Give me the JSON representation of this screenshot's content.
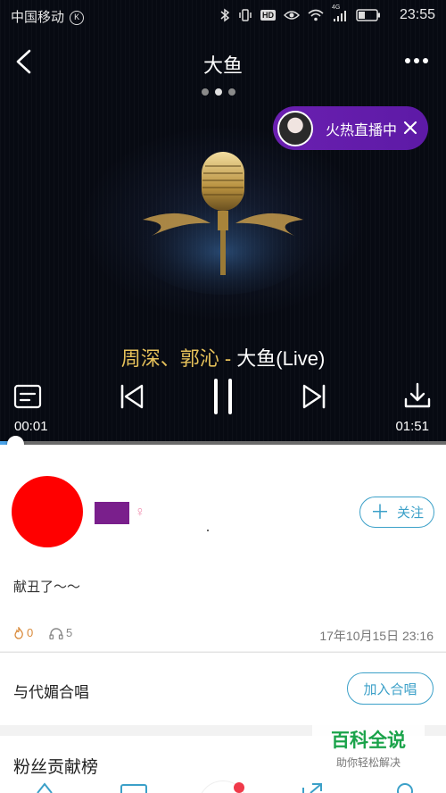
{
  "status_bar": {
    "carrier": "中国移动",
    "carrier_badge": "K",
    "signal_label": "4G",
    "hd_label": "HD",
    "time": "23:55"
  },
  "nav": {
    "title": "大鱼"
  },
  "live_banner": {
    "label": "火热直播中"
  },
  "song": {
    "artists": "周深、郭沁",
    "separator": " - ",
    "name": "大鱼(Live)"
  },
  "player": {
    "current_time": "00:01",
    "total_time": "01:51",
    "progress_fraction": 0.01
  },
  "post": {
    "gender_symbol": "♀",
    "follow_label": "关注",
    "follow_plus": "＋",
    "text": "献丑了～～",
    "likes": "0",
    "listens": "5",
    "date": "17年10月15日 23:16"
  },
  "chorus": {
    "label": "与代媚合唱",
    "join_label": "加入合唱"
  },
  "fans": {
    "label": "粉丝贡献榜"
  },
  "watermark": {
    "main": "百科全说",
    "sub": "助你轻松解决"
  },
  "colors": {
    "accent": "#3ba0c8",
    "live_purple": "#6a1fb0",
    "artist_gold": "#e6c15a",
    "progress_blue": "#4aa3e8"
  }
}
